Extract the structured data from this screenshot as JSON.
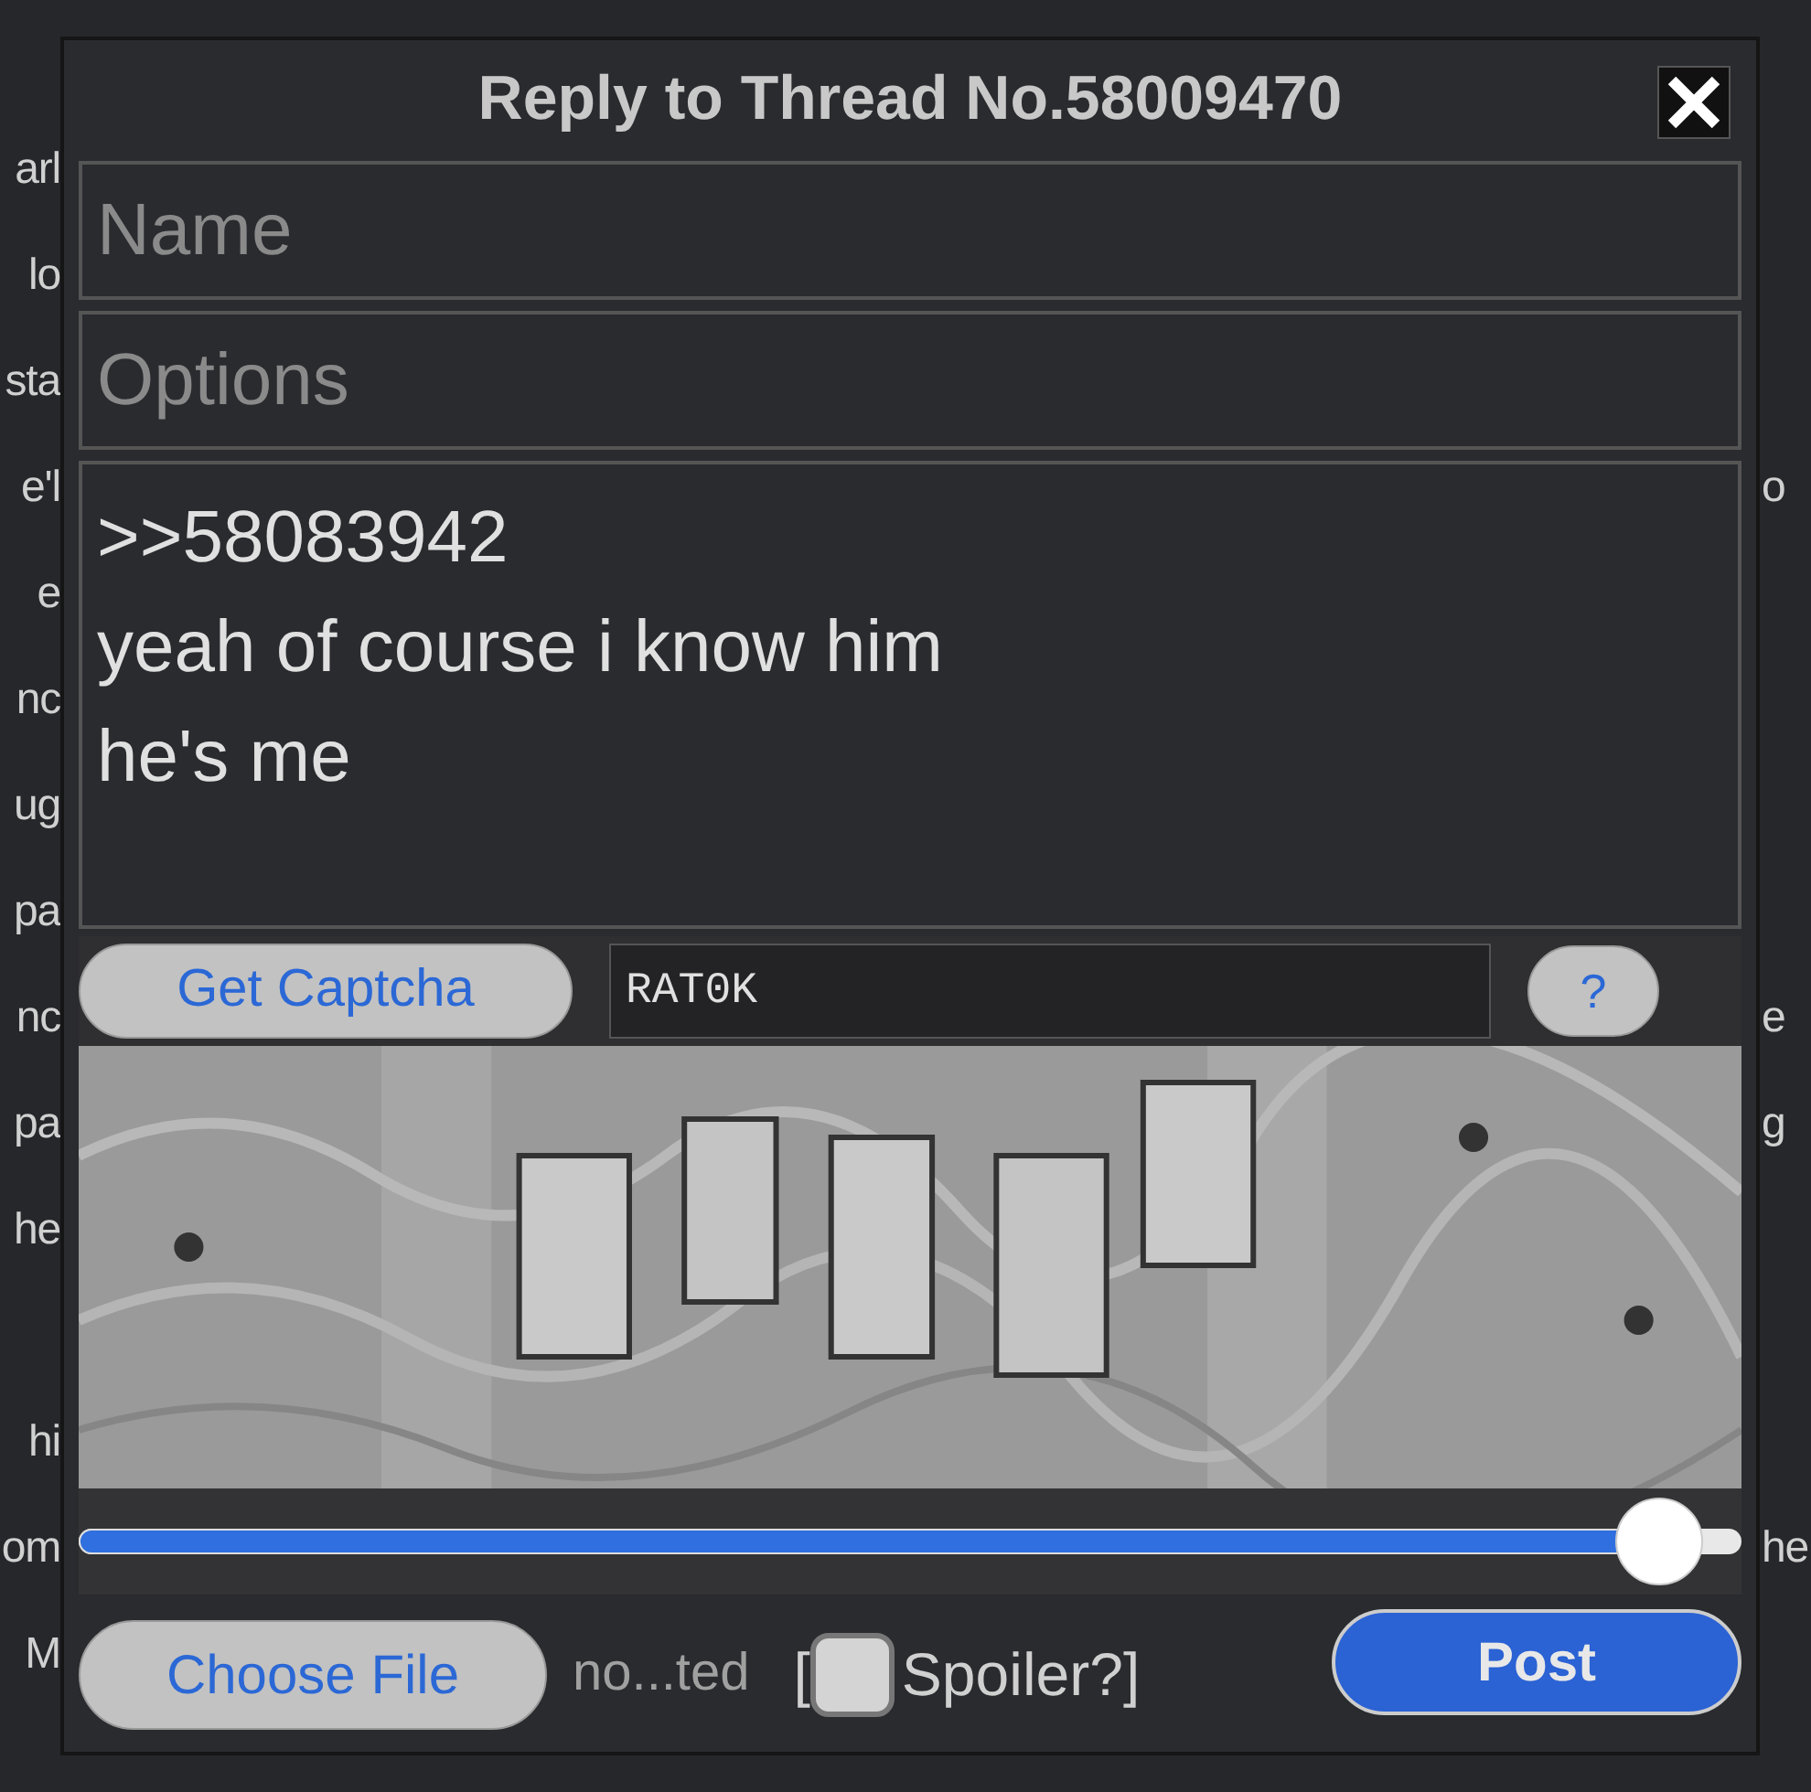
{
  "background_lines": [
    {
      "left": "arl"
    },
    {
      "left": "lo"
    },
    {
      "left": "sta"
    },
    {
      "left": "e'l",
      "right": "o"
    },
    {
      "left": "e"
    },
    {
      "left": "nc"
    },
    {
      "left": "ug"
    },
    {
      "left": "pa"
    },
    {
      "left": "nc",
      "right": "e"
    },
    {
      "left": "pa",
      "right": "g"
    },
    {
      "left": "he"
    },
    {
      "left": "hi",
      "gap_before": true
    },
    {
      "left": "om",
      "right": "he"
    },
    {
      "left": "M"
    }
  ],
  "dialog": {
    "title": "Reply to Thread No.58009470",
    "name_field": {
      "placeholder": "Name"
    },
    "options_field": {
      "placeholder": "Options"
    },
    "comment_field": {
      "value": ">>58083942\nyeah of course i know him\nhe's me"
    },
    "captcha": {
      "button": "Get Captcha",
      "value": "RAT0K",
      "help": "?",
      "slider": {
        "level": 0.95
      }
    },
    "file": {
      "button": "Choose File",
      "status": "no...ted"
    },
    "spoiler": {
      "open": "[",
      "label": "Spoiler?]",
      "checked": false
    },
    "post_button": "Post"
  }
}
